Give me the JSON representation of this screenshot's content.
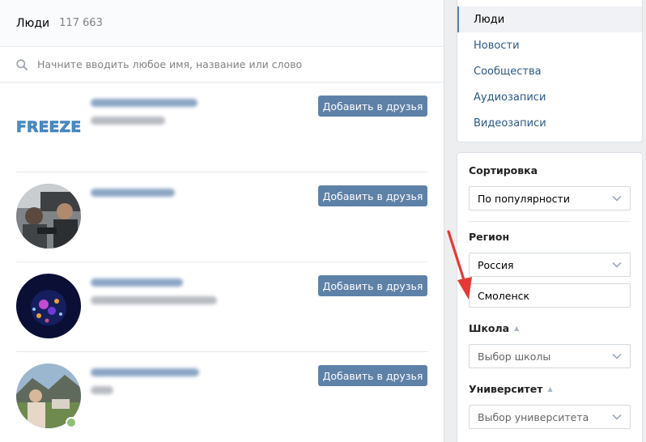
{
  "header": {
    "title": "Люди",
    "count": "117 663"
  },
  "search": {
    "placeholder": "Начните вводить любое имя, название или слово"
  },
  "people": [
    {
      "avatar_text": "FREEZE",
      "button_label": "Добавить в друзья"
    },
    {
      "button_label": "Добавить в друзья"
    },
    {
      "button_label": "Добавить в друзья"
    },
    {
      "button_label": "Добавить в друзья"
    }
  ],
  "nav": {
    "items": [
      {
        "label": "Люди"
      },
      {
        "label": "Новости"
      },
      {
        "label": "Сообщества"
      },
      {
        "label": "Аудиозаписи"
      },
      {
        "label": "Видеозаписи"
      }
    ]
  },
  "filters": {
    "sort": {
      "label": "Сортировка",
      "value": "По популярности"
    },
    "region": {
      "label": "Регион",
      "country": "Россия",
      "city": "Смоленск"
    },
    "school": {
      "label": "Школа",
      "placeholder": "Выбор школы"
    },
    "university": {
      "label": "Университет",
      "placeholder": "Выбор университета"
    }
  },
  "colors": {
    "accent": "#5e81a8",
    "link": "#2a5885",
    "annotation_arrow": "#e53935",
    "online": "#8ac176"
  },
  "icons": [
    "search-icon",
    "chevron-down-icon",
    "triangle-up-icon",
    "online-indicator"
  ]
}
